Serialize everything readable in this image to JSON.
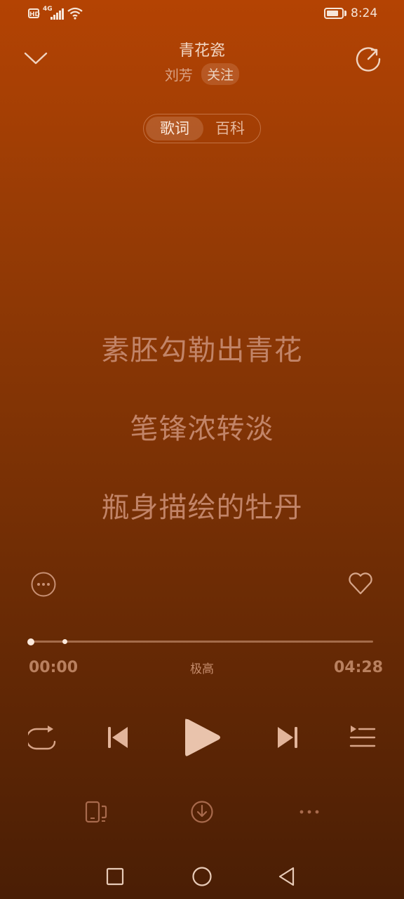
{
  "status_bar": {
    "hd": "HD",
    "network": "4G",
    "time": "8:24",
    "battery_percent": 80
  },
  "header": {
    "title": "青花瓷",
    "artist": "刘芳",
    "follow_label": "关注"
  },
  "tabs": [
    {
      "label": "歌词",
      "active": true
    },
    {
      "label": "百科",
      "active": false
    }
  ],
  "lyrics": [
    "素胚勾勒出青花",
    "笔锋浓转淡",
    "瓶身描绘的牡丹"
  ],
  "player": {
    "current_time": "00:00",
    "total_time": "04:28",
    "quality": "极高",
    "progress": 0.0
  },
  "icons": {
    "collapse": "chevron-down-icon",
    "share": "share-icon",
    "more": "more-circle-icon",
    "like": "heart-icon",
    "repeat": "repeat-icon",
    "previous": "skip-previous-icon",
    "play": "play-icon",
    "next": "skip-next-icon",
    "playlist": "playlist-icon",
    "device": "device-icon",
    "download": "download-icon",
    "more_options": "more-horizontal-icon"
  },
  "colors": {
    "bg_top": "#b44303",
    "bg_bottom": "#4a1e05",
    "accent": "#fbe9dc"
  }
}
